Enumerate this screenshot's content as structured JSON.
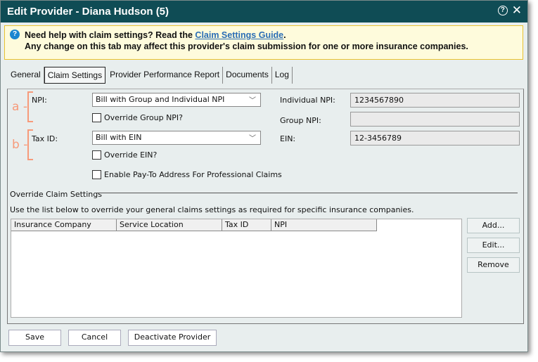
{
  "window": {
    "title": "Edit Provider - Diana Hudson (5)"
  },
  "banner": {
    "line1_prefix": "Need help with claim settings? Read the ",
    "link": "Claim Settings Guide",
    "line1_suffix": ".",
    "line2": "Any change on this tab may affect this provider's claim submission for one or more insurance companies."
  },
  "tabs": [
    {
      "label": "General"
    },
    {
      "label": "Claim Settings",
      "active": true
    },
    {
      "label": "Provider Performance Report"
    },
    {
      "label": "Documents"
    },
    {
      "label": "Log"
    }
  ],
  "annotations": {
    "a": "a -",
    "b": "b -"
  },
  "form": {
    "npi_label": "NPI:",
    "npi_value": "Bill with Group and Individual NPI",
    "override_group_npi": "Override Group NPI?",
    "taxid_label": "Tax ID:",
    "taxid_value": "Bill with EIN",
    "override_ein": "Override EIN?",
    "pay_to": "Enable Pay-To Address For Professional Claims",
    "individual_npi_label": "Individual NPI:",
    "individual_npi": "1234567890",
    "group_npi_label": "Group NPI:",
    "group_npi": "",
    "ein_label": "EIN:",
    "ein": "12-3456789"
  },
  "override": {
    "heading": "Override Claim Settings",
    "description": "Use the list below to override your general claims settings as required for specific insurance companies.",
    "columns": [
      "Insurance Company",
      "Service Location",
      "Tax ID",
      "NPI"
    ],
    "add": "Add...",
    "edit": "Edit...",
    "remove": "Remove"
  },
  "footer": {
    "save": "Save",
    "cancel": "Cancel",
    "deactivate": "Deactivate Provider"
  },
  "colors": {
    "titlebar": "#0f4c55",
    "annotation": "#f79a7a",
    "link": "#2a6db5"
  }
}
